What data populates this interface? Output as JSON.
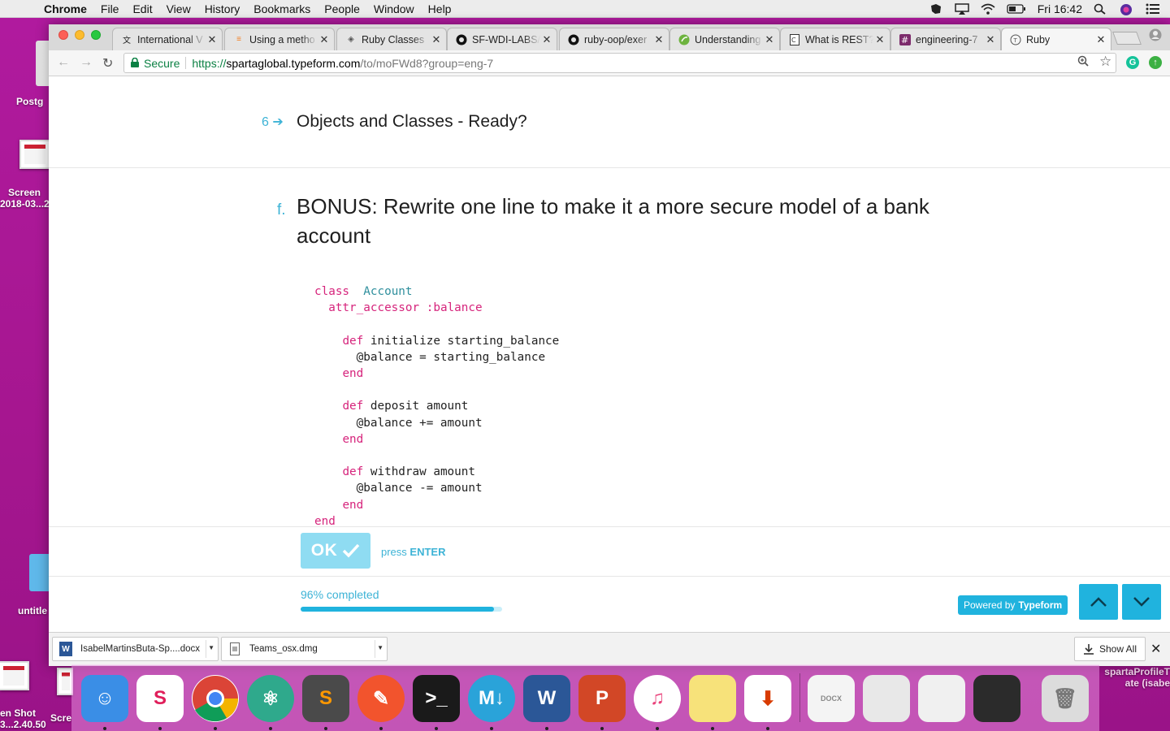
{
  "menubar": {
    "app": "Chrome",
    "items": [
      "File",
      "Edit",
      "View",
      "History",
      "Bookmarks",
      "People",
      "Window",
      "Help"
    ],
    "clock": "Fri 16:42"
  },
  "desktop": {
    "icons": [
      {
        "label": "Postg"
      },
      {
        "label": "Screen\n2018-03...2"
      },
      {
        "label": "untitle"
      },
      {
        "label": "en Shot\n3...2.40.50"
      },
      {
        "label": "Scre"
      },
      {
        "label": "spartaProfileT\nate (isabe"
      }
    ]
  },
  "tabs": [
    {
      "title": "International V",
      "icon": "translate-icon"
    },
    {
      "title": "Using a metho",
      "icon": "stackoverflow-icon"
    },
    {
      "title": "Ruby Classes",
      "icon": "ruby-icon"
    },
    {
      "title": "SF-WDI-LABS/",
      "icon": "github-icon"
    },
    {
      "title": "ruby-oop/exer",
      "icon": "github-icon"
    },
    {
      "title": "Understanding",
      "icon": "spring-icon"
    },
    {
      "title": "What is REST?",
      "icon": "doc-icon"
    },
    {
      "title": "engineering-7",
      "icon": "slack-icon"
    },
    {
      "title": "Ruby",
      "icon": "typeform-icon"
    }
  ],
  "address": {
    "secure_label": "Secure",
    "scheme": "https://",
    "host": "spartaglobal.typeform.com",
    "path": "/to/moFWd8?group=eng-7"
  },
  "form": {
    "prev_question": {
      "number": "6",
      "title": "Objects and Classes - Ready?"
    },
    "question": {
      "number": "f.",
      "title": "BONUS: Rewrite one line to make it a more secure model of a bank account"
    },
    "code_lines": [
      [
        [
          "kw",
          "class"
        ],
        [
          "",
          "  "
        ],
        [
          "cls",
          "Account"
        ]
      ],
      [
        [
          "",
          "  "
        ],
        [
          "kw",
          "attr_accessor"
        ],
        [
          "",
          " "
        ],
        [
          "sym",
          ":balance"
        ]
      ],
      [
        [
          "",
          ""
        ]
      ],
      [
        [
          "",
          "    "
        ],
        [
          "kw",
          "def"
        ],
        [
          "",
          " initialize starting_balance"
        ]
      ],
      [
        [
          "",
          "      @balance = starting_balance"
        ]
      ],
      [
        [
          "",
          "    "
        ],
        [
          "kw",
          "end"
        ]
      ],
      [
        [
          "",
          ""
        ]
      ],
      [
        [
          "",
          "    "
        ],
        [
          "kw",
          "def"
        ],
        [
          "",
          " deposit amount"
        ]
      ],
      [
        [
          "",
          "      @balance += amount"
        ]
      ],
      [
        [
          "",
          "    "
        ],
        [
          "kw",
          "end"
        ]
      ],
      [
        [
          "",
          ""
        ]
      ],
      [
        [
          "",
          "    "
        ],
        [
          "kw",
          "def"
        ],
        [
          "",
          " withdraw amount"
        ]
      ],
      [
        [
          "",
          "      @balance -= amount"
        ]
      ],
      [
        [
          "",
          "    "
        ],
        [
          "kw",
          "end"
        ]
      ],
      [
        [
          "kw",
          "end"
        ]
      ]
    ],
    "ok_label": "OK",
    "press_label": "press",
    "enter_label": "ENTER",
    "progress_text": "96% completed",
    "progress_fraction": 0.96,
    "powered_by": "Powered by",
    "brand": "Typeform"
  },
  "downloads": [
    {
      "name": "IsabelMartinsButa-Sp....docx",
      "icon": "word-doc-icon"
    },
    {
      "name": "Teams_osx.dmg",
      "icon": "dmg-icon"
    }
  ],
  "show_all": "Show All",
  "dock": [
    {
      "name": "finder",
      "color": "#3a8ee6"
    },
    {
      "name": "slack",
      "color": "#ffffff"
    },
    {
      "name": "chrome",
      "color": "#ffffff"
    },
    {
      "name": "atom",
      "color": "#2fa98c"
    },
    {
      "name": "sublime-text",
      "color": "#4a4a4a"
    },
    {
      "name": "paw",
      "color": "#f2542d"
    },
    {
      "name": "terminal",
      "color": "#1a1a1a"
    },
    {
      "name": "markdown",
      "color": "#2aa3d9"
    },
    {
      "name": "word",
      "color": "#2b5797"
    },
    {
      "name": "powerpoint",
      "color": "#d24726"
    },
    {
      "name": "itunes",
      "color": "#ffffff"
    },
    {
      "name": "notes",
      "color": "#f7e27a"
    },
    {
      "name": "office-installer",
      "color": "#ffffff"
    },
    {
      "name": "docx-file",
      "color": "#f4f4f4"
    },
    {
      "name": "screenshot-stack-1",
      "color": "#e8e8e8"
    },
    {
      "name": "screenshot-stack-2",
      "color": "#f0f0f0"
    },
    {
      "name": "screenshot-stack-3",
      "color": "#2b2b2b"
    },
    {
      "name": "trash",
      "color": "#dcdcdc"
    }
  ],
  "colors": {
    "accent": "#20b3de",
    "ok_button": "#8fdcf2",
    "code_keyword": "#d6247c",
    "code_class": "#2f8f9d",
    "desktop": "#a5168f"
  }
}
